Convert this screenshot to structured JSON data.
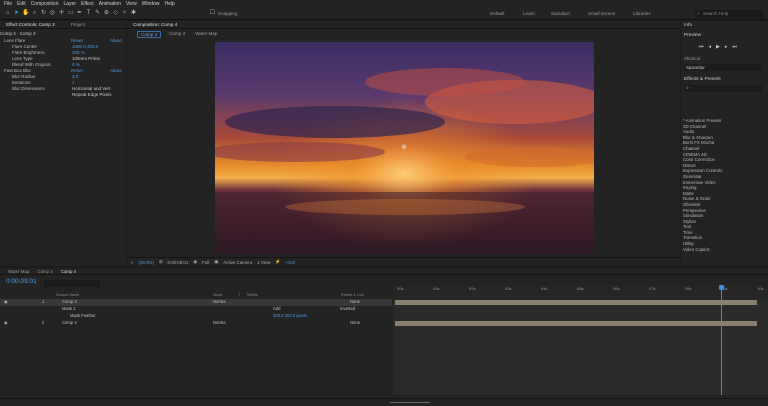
{
  "menubar": {
    "items": [
      "File",
      "Edit",
      "Composition",
      "Layer",
      "Effect",
      "Animation",
      "View",
      "Window",
      "Help"
    ]
  },
  "toolbar": {
    "snapping": "Snapping",
    "workspaces": [
      "Default",
      "Learn",
      "Standard",
      "Small Screen",
      "Libraries"
    ],
    "search_placeholder": "Search Help"
  },
  "effect_controls": {
    "tab": "Effect Controls: Comp 3",
    "project_tab": "Project",
    "subtitle": "Comp 4 · Comp 3",
    "rows": [
      {
        "label": "Lens Flare",
        "reset": "Reset",
        "about": "About"
      },
      {
        "label": "Flare Center",
        "value": "1000.0,400.0"
      },
      {
        "label": "Flare Brightness",
        "value": "100 %"
      },
      {
        "label": "Lens Type",
        "value": "105mm Prime"
      },
      {
        "label": "Blend With Original",
        "value": "0 %"
      },
      {
        "label": "Fast Box Blur",
        "reset": "Reset",
        "about": "About"
      },
      {
        "label": "Blur Radius",
        "value": "3.0"
      },
      {
        "label": "Iterations",
        "value": "1"
      },
      {
        "label": "Blur Dimensions",
        "value": "Horizontal and Vert"
      },
      {
        "label": "",
        "value": "Repeat Edge Pixels"
      }
    ]
  },
  "composition": {
    "title": "Composition: Comp 4",
    "tabs": [
      "Comp 4",
      "Comp 3",
      "Water Map"
    ],
    "viewer_bar": {
      "zoom": "(49.3%)",
      "time": "0:00:09:01",
      "resolution": "Full",
      "camera": "Active Camera",
      "views": "1 View",
      "offset": "+0.0"
    }
  },
  "right_panels": {
    "info": "Info",
    "preview": "Preview",
    "shortcut_label": "Shortcut",
    "shortcut_value": "Spacebar",
    "effects_title": "Effects & Presets",
    "effects": [
      "* Animation Presets",
      "3D Channel",
      "Audio",
      "Blur & Sharpen",
      "Boris FX Mocha",
      "Channel",
      "CINEMA 4D",
      "Color Correction",
      "Distort",
      "Expression Controls",
      "Generate",
      "Immersive Video",
      "Keying",
      "Matte",
      "Noise & Grain",
      "Obsolete",
      "Perspective",
      "Simulation",
      "Stylize",
      "Text",
      "Time",
      "Transition",
      "Utility",
      "Video Copilot"
    ]
  },
  "timeline": {
    "tabs": [
      "Water Map",
      "Comp 3",
      "Comp 4"
    ],
    "timecode": "0:00:09:01",
    "columns": [
      "Source Name",
      "Mode",
      "T",
      "TrkMat",
      "Parent & Link"
    ],
    "layers": [
      {
        "num": "1",
        "name": "Comp 3",
        "mode": "Norma",
        "parent": "None"
      },
      {
        "num": "",
        "name": "Mask 1",
        "mode": "Add",
        "parent": "Inverted"
      },
      {
        "num": "",
        "name": "Mask Feather",
        "mode": "",
        "parent": "",
        "value": "303.0,303.0 pixels"
      },
      {
        "num": "2",
        "name": "Comp 3",
        "mode": "Norma",
        "parent": "None"
      }
    ],
    "ruler": [
      "00s",
      "01s",
      "02s",
      "03s",
      "04s",
      "05s",
      "06s",
      "07s",
      "08s",
      "09s",
      "10s"
    ],
    "playhead_seconds": 9.0
  },
  "colors": {
    "accent": "#4f9ae6",
    "bar": "#8a8070"
  }
}
